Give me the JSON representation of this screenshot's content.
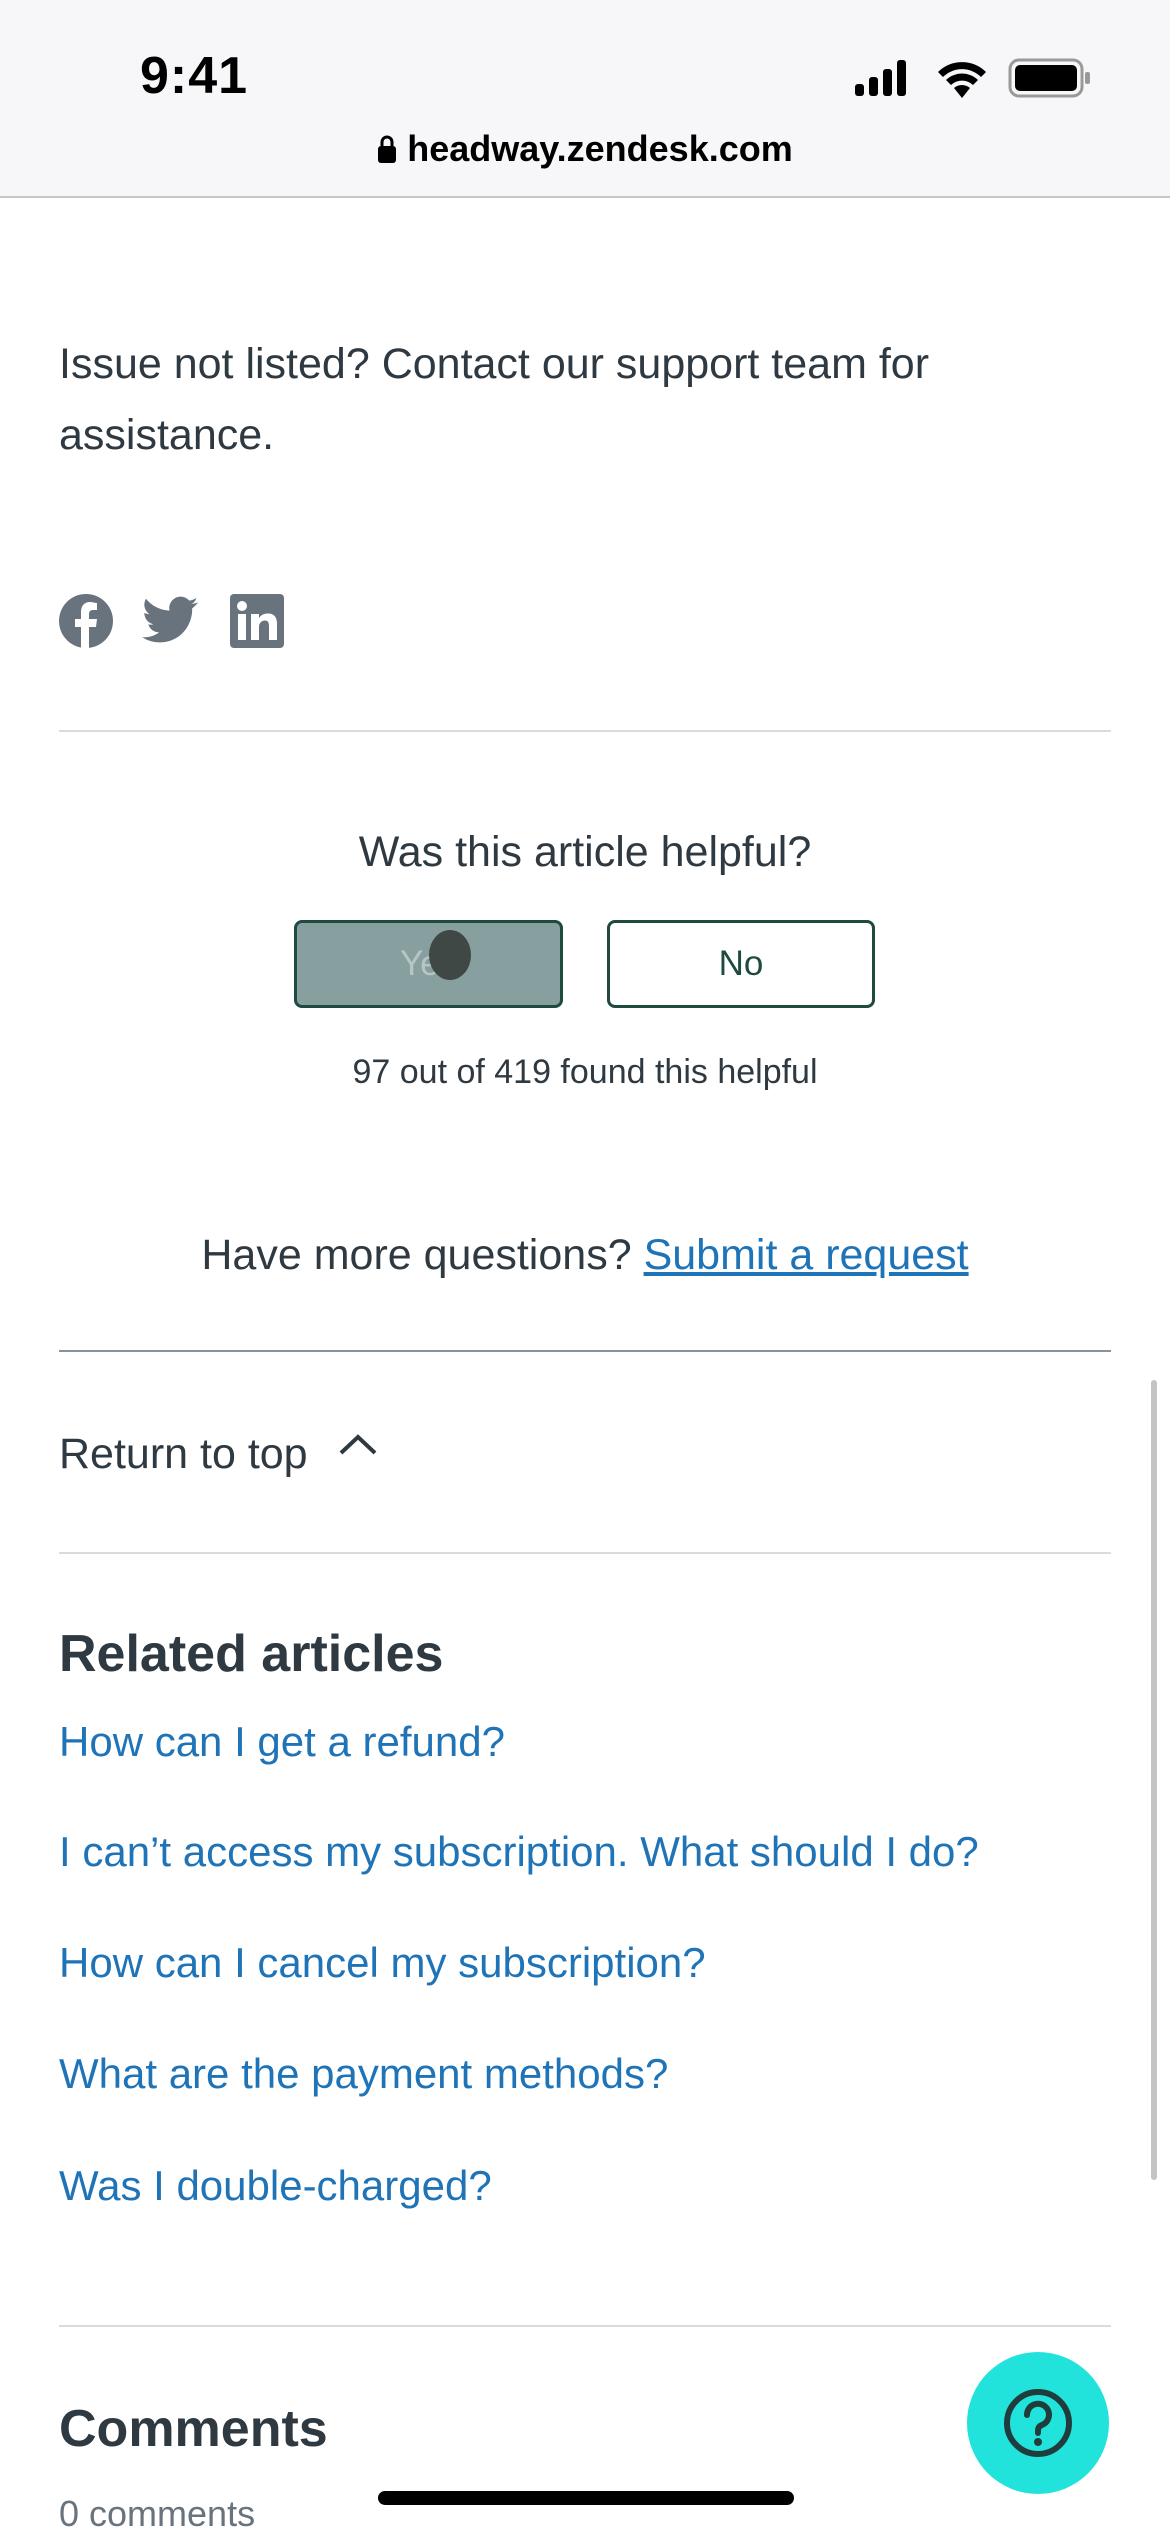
{
  "status_bar": {
    "time": "9:41",
    "url": "headway.zendesk.com",
    "icons": [
      "signal-icon",
      "wifi-icon",
      "battery-icon",
      "lock-icon"
    ]
  },
  "article": {
    "paragraph_line1": "Issue not listed? Contact our support team for",
    "paragraph_line2": "assistance.",
    "share_icons": [
      "facebook-icon",
      "twitter-icon",
      "linkedin-icon"
    ]
  },
  "vote": {
    "question": "Was this article helpful?",
    "yes_label": "Yes",
    "no_label": "No",
    "summary": "97 out of 419 found this helpful"
  },
  "more": {
    "prefix": "Have more questions?",
    "link": "Submit a request"
  },
  "return_top": "Return to top",
  "related": {
    "title": "Related articles",
    "items": [
      "How can I get a refund?",
      "I can’t access my subscription. What should I do?",
      "How can I cancel my subscription?",
      "What are the payment methods?",
      "Was I double-charged?"
    ]
  },
  "comments": {
    "title": "Comments",
    "count": "0 comments"
  },
  "colors": {
    "link": "#1f73b7",
    "help_button": "#22e3dc",
    "yes_button": "#87a09f",
    "button_border": "#1f4a40"
  }
}
